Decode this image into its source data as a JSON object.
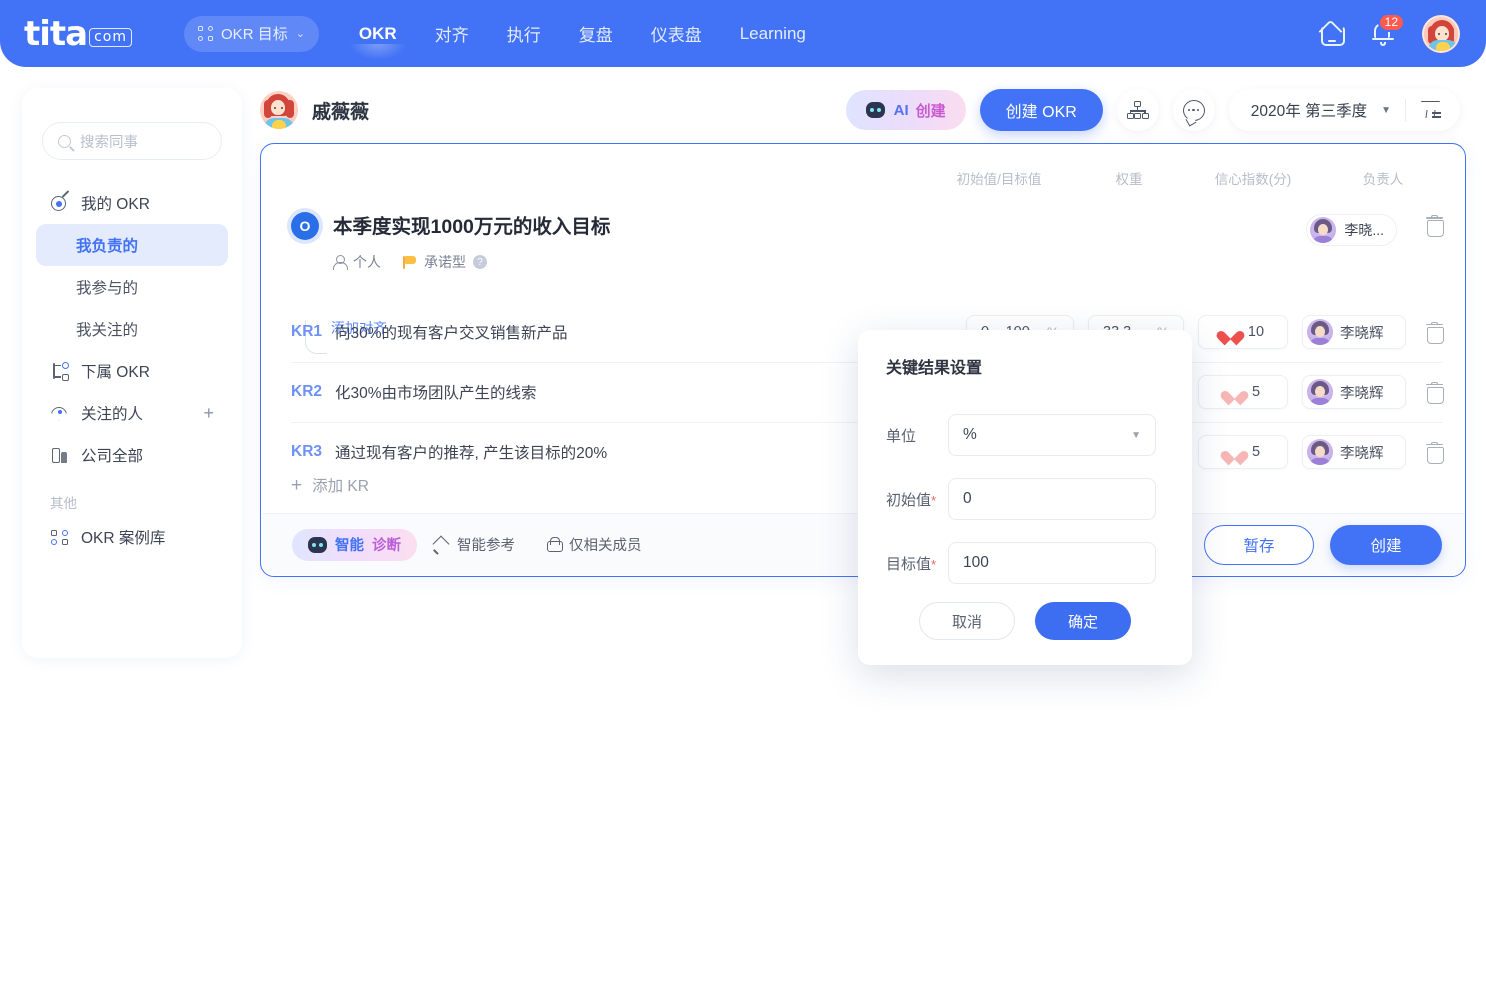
{
  "topnav": {
    "logo_main": "tita",
    "logo_suffix": "com",
    "switcher_label": "OKR 目标",
    "items": [
      {
        "label": "OKR",
        "active": true
      },
      {
        "label": "对齐",
        "active": false
      },
      {
        "label": "执行",
        "active": false
      },
      {
        "label": "复盘",
        "active": false
      },
      {
        "label": "仪表盘",
        "active": false
      },
      {
        "label": "Learning",
        "active": false
      }
    ],
    "notification_count": "12",
    "accent": "#4272f5"
  },
  "sidebar": {
    "search_placeholder": "搜索同事",
    "items": [
      {
        "label": "我的 OKR"
      },
      {
        "label": "我负责的"
      },
      {
        "label": "我参与的"
      },
      {
        "label": "我关注的"
      },
      {
        "label": "下属 OKR"
      },
      {
        "label": "关注的人",
        "action": "+"
      },
      {
        "label": "公司全部"
      }
    ],
    "group_label": "其他",
    "other_items": [
      {
        "label": "OKR 案例库"
      }
    ]
  },
  "header": {
    "user_name": "戚薇薇",
    "ai_create_part1": "AI",
    "ai_create_part2": "创建",
    "create_okr": "创建 OKR",
    "quarter": "2020年 第三季度"
  },
  "card": {
    "align_link": "添加对齐",
    "columns": [
      "初始值/目标值",
      "权重",
      "信心指数(分)",
      "负责人"
    ],
    "objective": {
      "badge": "O",
      "title": "本季度实现1000万元的收入目标",
      "meta_type": "个人",
      "meta_commit": "承诺型",
      "owner": "李晓..."
    },
    "krs": [
      {
        "tag": "KR1",
        "text": "向30%的现有客户交叉销售新产品",
        "range": "0 ~ 100",
        "range_unit": "%",
        "weight": "33.3",
        "weight_unit": "%",
        "confidence": "10",
        "owner": "李晓辉"
      },
      {
        "tag": "KR2",
        "text": "化30%由市场团队产生的线索",
        "range": "",
        "range_unit": "",
        "weight": "",
        "weight_unit": "",
        "confidence": "5",
        "owner": "李晓辉"
      },
      {
        "tag": "KR3",
        "text": "通过现有客户的推荐, 产生该目标的20%",
        "range": "",
        "range_unit": "",
        "weight": "",
        "weight_unit": "",
        "confidence": "5",
        "owner": "李晓辉"
      }
    ],
    "add_kr": "添加 KR",
    "footer": {
      "diagnosis_part1": "智能",
      "diagnosis_part2": "诊断",
      "reference": "智能参考",
      "visibility": "仅相关成员",
      "save_draft": "暂存",
      "create": "创建"
    }
  },
  "modal": {
    "title": "关键结果设置",
    "unit_label": "单位",
    "unit_value": "%",
    "start_label": "初始值",
    "start_value": "0",
    "target_label": "目标值",
    "target_value": "100",
    "required_mark": "*",
    "cancel": "取消",
    "confirm": "确定"
  }
}
